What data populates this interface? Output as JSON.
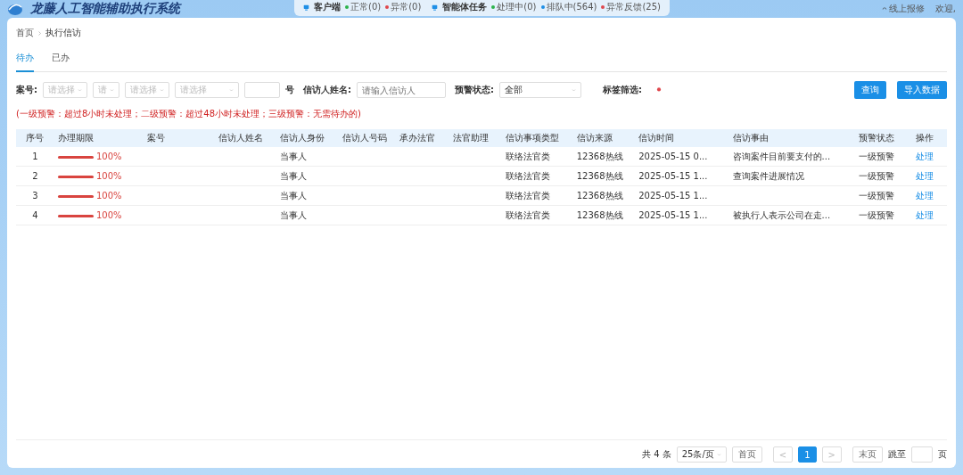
{
  "header": {
    "title": "龙藤人工智能辅助执行系统",
    "status_groups": [
      {
        "label": "客户端",
        "items": [
          {
            "text": "正常(0)",
            "color": "#2bb34a"
          },
          {
            "text": "异常(0)",
            "color": "#e0474c"
          }
        ]
      },
      {
        "label": "智能体任务",
        "items": [
          {
            "text": "处理中(0)",
            "color": "#2bb34a"
          },
          {
            "text": "排队中(564)",
            "color": "#1f8fe6"
          },
          {
            "text": "异常反馈(25)",
            "color": "#e0474c"
          }
        ]
      }
    ],
    "repair": "线上报修",
    "welcome": "欢迎,"
  },
  "breadcrumb": [
    "首页",
    "执行信访"
  ],
  "tabs": [
    {
      "label": "待办",
      "selected": true
    },
    {
      "label": "已办",
      "selected": false
    }
  ],
  "filters": {
    "case_label": "案号:",
    "case_selects": [
      "请选择",
      "请",
      "请选择",
      "请选择"
    ],
    "case_suffix": "号",
    "name_label": "信访人姓名:",
    "name_placeholder": "请输入信访人",
    "warn_label": "预警状态:",
    "warn_value": "全部",
    "tag_label": "标签筛选:"
  },
  "buttons": [
    "查询",
    "导入数据"
  ],
  "note": "(一级预警：超过8小时未处理；二级预警：超过48小时未处理；三级预警：无需待办的)",
  "table": {
    "columns": [
      "序号",
      "办理期限",
      "案号",
      "信访人姓名",
      "信访人身份",
      "信访人号码",
      "承办法官",
      "法官助理",
      "信访事项类型",
      "信访来源",
      "信访时间",
      "信访事由",
      "预警状态",
      "操作"
    ],
    "rows": [
      {
        "index": "1",
        "level": 1,
        "percent": "100%",
        "identity": "当事人",
        "type": "联络法官类",
        "source": "12368热线",
        "time": "2025-05-15 0...",
        "reason": "咨询案件目前要支付的...",
        "warning": "一级预警",
        "action": "处理"
      },
      {
        "index": "2",
        "level": 1,
        "percent": "100%",
        "identity": "当事人",
        "type": "联络法官类",
        "source": "12368热线",
        "time": "2025-05-15 1...",
        "reason": "查询案件进展情况",
        "warning": "一级预警",
        "action": "处理"
      },
      {
        "index": "3",
        "level": 1,
        "percent": "100%",
        "identity": "当事人",
        "type": "联络法官类",
        "source": "12368热线",
        "time": "2025-05-15 1...",
        "warning": "一级预警",
        "action": "处理"
      },
      {
        "index": "4",
        "level": 1,
        "percent": "100%",
        "identity": "当事人",
        "type": "联络法官类",
        "source": "12368热线",
        "time": "2025-05-15 1...",
        "reason": "被执行人表示公司在走...",
        "warning": "一级预警",
        "action": "处理"
      }
    ]
  },
  "pagination": {
    "total": "共 4 条",
    "page_size": "25条/页",
    "first": "首页",
    "prev": "<",
    "pages": [
      {
        "label": "1",
        "selected": true
      }
    ],
    "next": ">",
    "last": "末页",
    "goto": "跳至",
    "goto_suffix": "页"
  }
}
